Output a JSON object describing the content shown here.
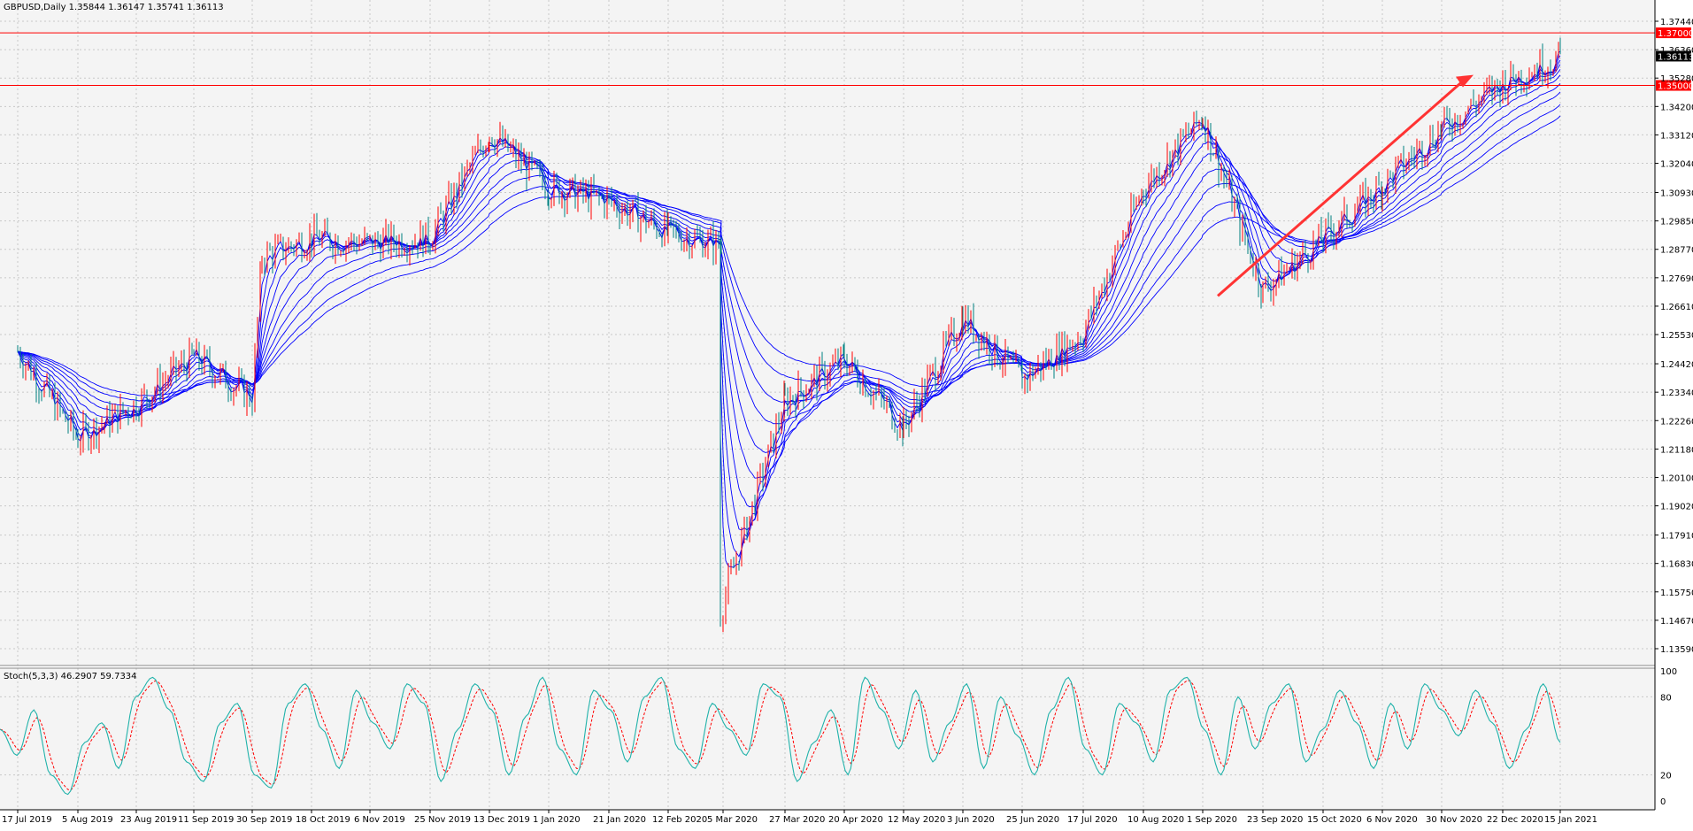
{
  "chart_data": [
    {
      "type": "candlestick",
      "symbol_header": "GBPUSD,Daily  1.35844 1.36147 1.35741 1.36113",
      "y_ticks": [
        "1.37440",
        "1.36360",
        "1.35280",
        "1.34200",
        "1.33120",
        "1.32040",
        "1.30930",
        "1.29850",
        "1.28770",
        "1.27690",
        "1.26610",
        "1.25530",
        "1.24420",
        "1.23340",
        "1.22260",
        "1.21180",
        "1.20100",
        "1.19020",
        "1.17910",
        "1.16830",
        "1.15750",
        "1.14670",
        "1.13590"
      ],
      "y_tick_values": [
        1.3744,
        1.3636,
        1.3528,
        1.342,
        1.3312,
        1.3204,
        1.3093,
        1.2985,
        1.2877,
        1.2769,
        1.2661,
        1.2553,
        1.2442,
        1.2334,
        1.2226,
        1.2118,
        1.201,
        1.1902,
        1.1791,
        1.1683,
        1.1575,
        1.1467,
        1.1359
      ],
      "horizontal_lines": [
        {
          "label": "1.37000",
          "value": 1.37,
          "color": "#ff0000"
        },
        {
          "label": "1.35000",
          "value": 1.35,
          "color": "#ff0000"
        }
      ],
      "current_price": {
        "label": "1.36113",
        "value": 1.36113
      },
      "x_labels": [
        "17 Jul 2019",
        "5 Aug 2019",
        "23 Aug 2019",
        "11 Sep 2019",
        "30 Sep 2019",
        "18 Oct 2019",
        "6 Nov 2019",
        "25 Nov 2019",
        "13 Dec 2019",
        "1 Jan 2020",
        "21 Jan 2020",
        "12 Feb 2020",
        "5 Mar 2020",
        "27 Mar 2020",
        "20 Apr 2020",
        "12 May 2020",
        "3 Jun 2020",
        "25 Jun 2020",
        "17 Jul 2020",
        "10 Aug 2020",
        "1 Sep 2020",
        "23 Sep 2020",
        "15 Oct 2020",
        "6 Nov 2020",
        "30 Nov 2020",
        "22 Dec 2020",
        "15 Jan 2021"
      ],
      "close_series": [
        {
          "date": "17 Jul 2019",
          "close": 1.249
        },
        {
          "date": "5 Aug 2019",
          "close": 1.216
        },
        {
          "date": "23 Aug 2019",
          "close": 1.229
        },
        {
          "date": "11 Sep 2019",
          "close": 1.247
        },
        {
          "date": "30 Sep 2019",
          "close": 1.231
        },
        {
          "date": "10 Oct 2019",
          "close": 1.285
        },
        {
          "date": "18 Oct 2019",
          "close": 1.292
        },
        {
          "date": "6 Nov 2019",
          "close": 1.29
        },
        {
          "date": "25 Nov 2019",
          "close": 1.292
        },
        {
          "date": "13 Dec 2019",
          "close": 1.332
        },
        {
          "date": "1 Jan 2020",
          "close": 1.311
        },
        {
          "date": "21 Jan 2020",
          "close": 1.306
        },
        {
          "date": "12 Feb 2020",
          "close": 1.294
        },
        {
          "date": "5 Mar 2020",
          "close": 1.289
        },
        {
          "date": "19 Mar 2020",
          "close": 1.15
        },
        {
          "date": "27 Mar 2020",
          "close": 1.23
        },
        {
          "date": "20 Apr 2020",
          "close": 1.246
        },
        {
          "date": "12 May 2020",
          "close": 1.22
        },
        {
          "date": "3 Jun 2020",
          "close": 1.262
        },
        {
          "date": "25 Jun 2020",
          "close": 1.238
        },
        {
          "date": "17 Jul 2020",
          "close": 1.256
        },
        {
          "date": "10 Aug 2020",
          "close": 1.311
        },
        {
          "date": "1 Sep 2020",
          "close": 1.338
        },
        {
          "date": "23 Sep 2020",
          "close": 1.272
        },
        {
          "date": "15 Oct 2020",
          "close": 1.292
        },
        {
          "date": "6 Nov 2020",
          "close": 1.312
        },
        {
          "date": "30 Nov 2020",
          "close": 1.334
        },
        {
          "date": "22 Dec 2020",
          "close": 1.351
        },
        {
          "date": "15 Jan 2021",
          "close": 1.361
        }
      ],
      "moving_averages_color": "#0000ff",
      "bull_color": "#ff0000",
      "bear_color": "#008080",
      "trend_arrow": {
        "from_date": "23 Sep 2020",
        "from_value": 1.27,
        "to_date": "15 Jan 2021",
        "to_value": 1.354,
        "color": "#ff3333"
      }
    },
    {
      "type": "line",
      "indicator_header": "Stoch(5,3,3) 46.2907 59.7334",
      "y_ticks": [
        "100",
        "80",
        "20",
        "0"
      ],
      "y_tick_values": [
        100,
        80,
        20,
        0
      ],
      "ylim": [
        0,
        100
      ],
      "main_color": "#20b2aa",
      "signal_color": "#ff0000",
      "main_series": [
        55,
        35,
        70,
        20,
        5,
        45,
        60,
        25,
        80,
        95,
        70,
        30,
        15,
        60,
        75,
        20,
        10,
        75,
        90,
        55,
        25,
        85,
        60,
        40,
        90,
        75,
        15,
        55,
        90,
        70,
        20,
        65,
        95,
        40,
        20,
        85,
        70,
        30,
        80,
        95,
        40,
        25,
        75,
        55,
        35,
        90,
        80,
        15,
        45,
        70,
        20,
        95,
        70,
        40,
        85,
        30,
        60,
        90,
        25,
        80,
        50,
        20,
        70,
        95,
        40,
        20,
        75,
        60,
        30,
        85,
        95,
        55,
        20,
        80,
        40,
        75,
        90,
        30,
        55,
        85,
        60,
        25,
        75,
        40,
        90,
        70,
        50,
        85,
        60,
        25,
        55,
        90,
        45
      ]
    }
  ]
}
